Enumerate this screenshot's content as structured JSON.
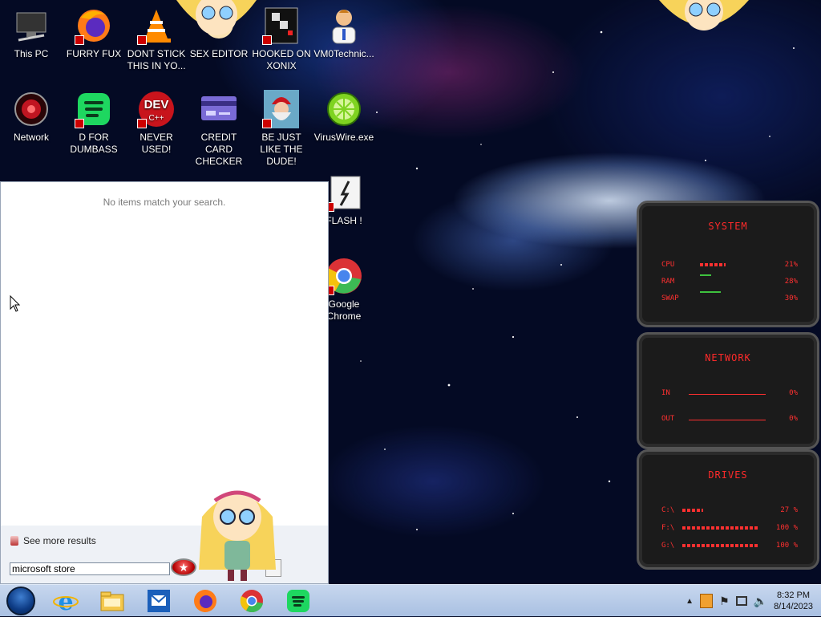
{
  "desktop": {
    "icons": [
      {
        "label": "This PC"
      },
      {
        "label": "FURRY FUX"
      },
      {
        "label": "DONT STICK THIS IN YO..."
      },
      {
        "label": "SEX EDITOR"
      },
      {
        "label": "HOOKED ON XONIX"
      },
      {
        "label": "VM0Technic..."
      },
      {
        "label": "Network"
      },
      {
        "label": "D FOR DUMBASS"
      },
      {
        "label": "NEVER USED!"
      },
      {
        "label": "CREDIT CARD CHECKER"
      },
      {
        "label": "BE JUST LIKE THE DUDE!"
      },
      {
        "label": "VirusWire.exe"
      },
      {
        "label": "FLASH !"
      },
      {
        "label": "Google Chrome"
      }
    ],
    "dev_icon_text": "DEV"
  },
  "search_panel": {
    "no_items_text": "No items match your search.",
    "see_more_label": "See more results",
    "query": "microsoft store"
  },
  "widget": {
    "system": {
      "title": "SYSTEM",
      "rows": [
        {
          "label": "CPU",
          "value": "21%",
          "level": 0.21
        },
        {
          "label": "RAM",
          "value": "28%",
          "level": 0.28
        },
        {
          "label": "SWAP",
          "value": "30%",
          "level": 0.3
        }
      ]
    },
    "network": {
      "title": "NETWORK",
      "rows": [
        {
          "label": "IN",
          "value": "0%"
        },
        {
          "label": "OUT",
          "value": "0%"
        }
      ]
    },
    "drives": {
      "title": "DRIVES",
      "rows": [
        {
          "label": "C:\\",
          "value": "27 %",
          "level": 0.27
        },
        {
          "label": "F:\\",
          "value": "100 %",
          "level": 1.0
        },
        {
          "label": "G:\\",
          "value": "100 %",
          "level": 1.0
        }
      ]
    },
    "accent_color": "#ff3030"
  },
  "taskbar": {
    "apps": [
      "internet-explorer",
      "file-explorer",
      "mail",
      "firefox",
      "chrome",
      "spotify"
    ],
    "clock": {
      "time": "8:32 PM",
      "date": "8/14/2023"
    }
  }
}
